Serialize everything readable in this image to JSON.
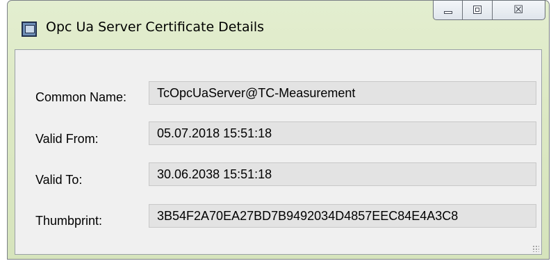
{
  "window": {
    "title": "Opc Ua Server Certificate Details",
    "icon": "certificate-window-icon",
    "caption": {
      "minimize_icon": "minimize-icon",
      "maximize_icon": "maximize-icon",
      "close_glyph": "☒"
    }
  },
  "fields": [
    {
      "label": "Common Name:",
      "value": "TcOpcUaServer@TC-Measurement"
    },
    {
      "label": "Valid From:",
      "value": "05.07.2018 15:51:18"
    },
    {
      "label": "Valid To:",
      "value": "30.06.2038 15:51:18"
    },
    {
      "label": "Thumbprint:",
      "value": "3B54F2A70EA27BD7B9492034D4857EEC84E4A3C8"
    }
  ],
  "colors": {
    "title_bar": "#dde9c4",
    "client": "#f0f0f0",
    "field_bg": "#e3e3e3"
  }
}
